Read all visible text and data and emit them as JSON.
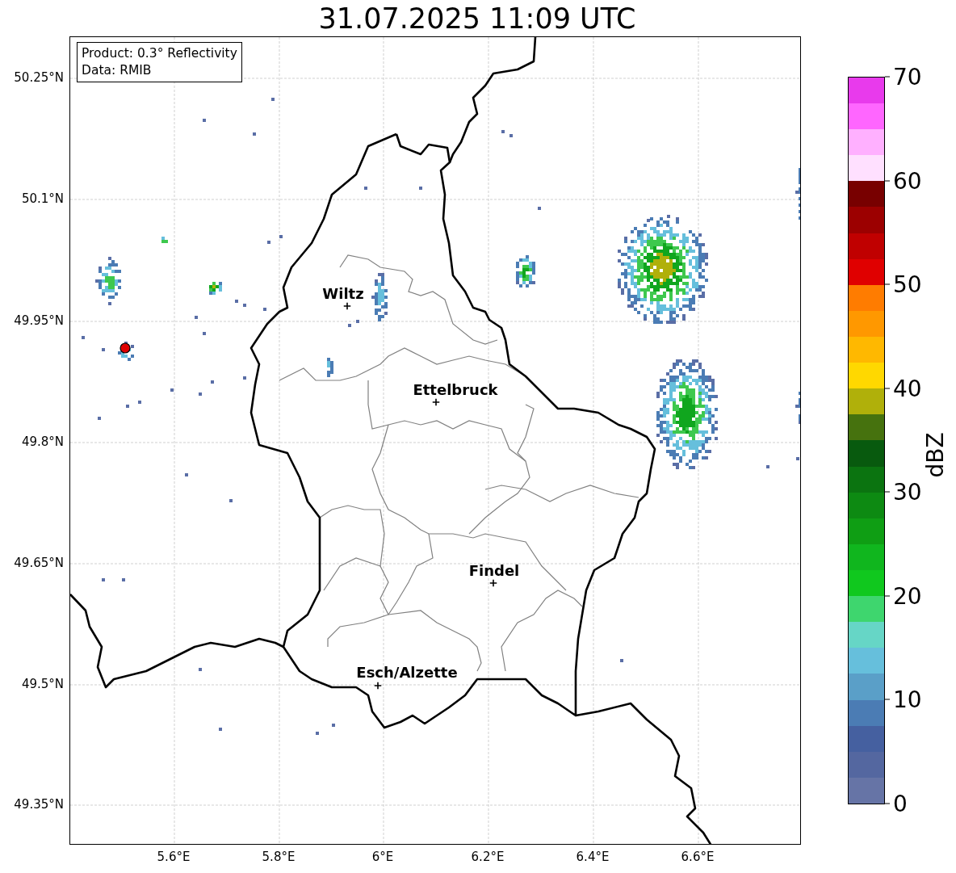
{
  "title": "31.07.2025 11:09 UTC",
  "legend": [
    "Product: 0.3° Reflectivity",
    "Data: RMIB"
  ],
  "lat_labels": [
    "50.25°N",
    "50.1°N",
    "49.95°N",
    "49.8°N",
    "49.65°N",
    "49.5°N",
    "49.35°N"
  ],
  "lon_labels": [
    "5.6°E",
    "5.8°E",
    "6°E",
    "6.2°E",
    "6.4°E",
    "6.6°E"
  ],
  "cities": [
    {
      "name": "Wiltz"
    },
    {
      "name": "Ettelbruck"
    },
    {
      "name": "Findel"
    },
    {
      "name": "Esch/Alzette"
    }
  ],
  "colorbar": {
    "label": "dBZ",
    "ticks": [
      "70",
      "60",
      "50",
      "40",
      "30",
      "20",
      "10",
      "0"
    ],
    "segments": [
      {
        "color": "#6674a6"
      },
      {
        "color": "#5467a0"
      },
      {
        "color": "#4560a0"
      },
      {
        "color": "#4b7cb4"
      },
      {
        "color": "#5a9fc8"
      },
      {
        "color": "#66bfdc"
      },
      {
        "color": "#66d6c6"
      },
      {
        "color": "#3ed66e"
      },
      {
        "color": "#10c81e"
      },
      {
        "color": "#10b61e"
      },
      {
        "color": "#0f9e14"
      },
      {
        "color": "#0d8a12"
      },
      {
        "color": "#0b7410"
      },
      {
        "color": "#085a0e"
      },
      {
        "color": "#46720e"
      },
      {
        "color": "#b0b00a"
      },
      {
        "color": "#ffd800"
      },
      {
        "color": "#ffb800"
      },
      {
        "color": "#ff9800"
      },
      {
        "color": "#ff7c00"
      },
      {
        "color": "#e00000"
      },
      {
        "color": "#c00000"
      },
      {
        "color": "#9c0000"
      },
      {
        "color": "#780000"
      },
      {
        "color": "#ffe0ff"
      },
      {
        "color": "#ffb0ff"
      },
      {
        "color": "#ff66ff"
      },
      {
        "color": "#e83aec"
      }
    ]
  }
}
